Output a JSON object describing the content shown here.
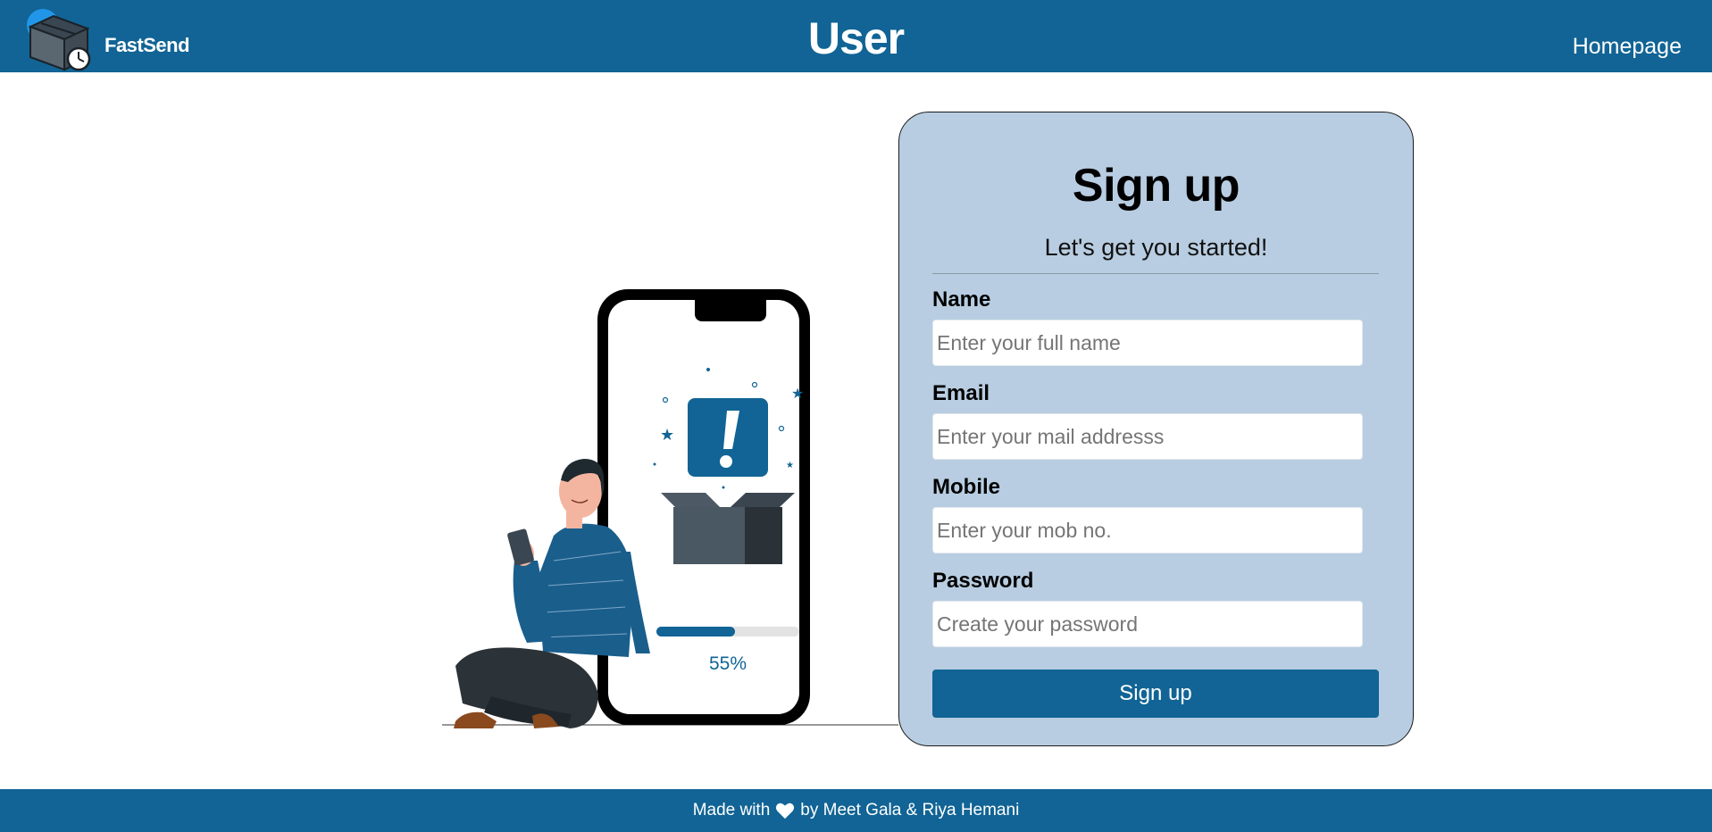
{
  "header": {
    "brand": "FastSend",
    "title": "User",
    "nav_home": "Homepage"
  },
  "illustration": {
    "progress_text": "55%",
    "progress_value": 0.55
  },
  "form": {
    "title": "Sign up",
    "subtitle": "Let's get you started!",
    "fields": [
      {
        "label": "Name",
        "placeholder": "Enter your full name",
        "value": ""
      },
      {
        "label": "Email",
        "placeholder": "Enter your mail addresss",
        "value": ""
      },
      {
        "label": "Mobile",
        "placeholder": "Enter your mob no.",
        "value": ""
      },
      {
        "label": "Password",
        "placeholder": "Create your password",
        "value": ""
      }
    ],
    "submit_label": "Sign up"
  },
  "footer": {
    "made_with": "Made with",
    "heart_icon": "heart-icon",
    "credits": "by Meet Gala & Riya Hemani"
  },
  "colors": {
    "primary": "#116495",
    "card_bg": "#b8cde1"
  }
}
